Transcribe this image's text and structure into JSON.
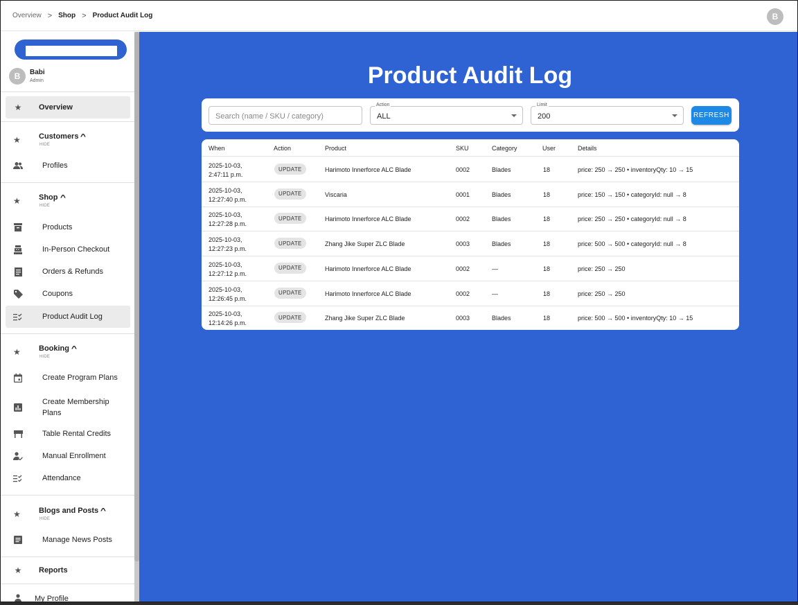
{
  "breadcrumb": {
    "items": [
      "Overview",
      "Shop",
      "Product Audit Log"
    ],
    "separator": ">"
  },
  "top_avatar": "B",
  "user": {
    "initial": "B",
    "name": "Babi",
    "role": "Admin"
  },
  "sidebar": {
    "overview": "Overview",
    "customers": {
      "title": "Customers",
      "hide": "HIDE",
      "items": [
        "Profiles"
      ]
    },
    "shop": {
      "title": "Shop",
      "hide": "HIDE",
      "items": [
        "Products",
        "In-Person Checkout",
        "Orders & Refunds",
        "Coupons",
        "Product Audit Log"
      ]
    },
    "booking": {
      "title": "Booking",
      "hide": "HIDE",
      "items": [
        "Create Program Plans",
        "Create Membership Plans",
        "Table Rental Credits",
        "Manual Enrollment",
        "Attendance"
      ]
    },
    "blogs": {
      "title": "Blogs and Posts",
      "hide": "HIDE",
      "items": [
        "Manage News Posts"
      ]
    },
    "reports": "Reports",
    "my_profile": "My Profile"
  },
  "page_title": "Product Audit Log",
  "filters": {
    "search_placeholder": "Search (name / SKU / category)",
    "action_label": "Action",
    "action_value": "ALL",
    "limit_label": "Limit",
    "limit_value": "200",
    "refresh_label": "REFRESH"
  },
  "table": {
    "headers": [
      "When",
      "Action",
      "Product",
      "SKU",
      "Category",
      "User",
      "Details"
    ],
    "rows": [
      {
        "when": [
          "2025-10-03,",
          "2:47:11 p.m."
        ],
        "action": "UPDATE",
        "product": "Harimoto Innerforce ALC Blade",
        "sku": "0002",
        "category": "Blades",
        "user": "18",
        "details": "price: 250 → 250 • inventoryQty: 10 → 15"
      },
      {
        "when": [
          "2025-10-03,",
          "12:27:40 p.m."
        ],
        "action": "UPDATE",
        "product": "Viscaria",
        "sku": "0001",
        "category": "Blades",
        "user": "18",
        "details": "price: 150 → 150 • categoryId: null → 8"
      },
      {
        "when": [
          "2025-10-03,",
          "12:27:28 p.m."
        ],
        "action": "UPDATE",
        "product": "Harimoto Innerforce ALC Blade",
        "sku": "0002",
        "category": "Blades",
        "user": "18",
        "details": "price: 250 → 250 • categoryId: null → 8"
      },
      {
        "when": [
          "2025-10-03,",
          "12:27:23 p.m."
        ],
        "action": "UPDATE",
        "product": "Zhang Jike Super ZLC Blade",
        "sku": "0003",
        "category": "Blades",
        "user": "18",
        "details": "price: 500 → 500 • categoryId: null → 8"
      },
      {
        "when": [
          "2025-10-03,",
          "12:27:12 p.m."
        ],
        "action": "UPDATE",
        "product": "Harimoto Innerforce ALC Blade",
        "sku": "0002",
        "category": "—",
        "user": "18",
        "details": "price: 250 → 250"
      },
      {
        "when": [
          "2025-10-03,",
          "12:26:45 p.m."
        ],
        "action": "UPDATE",
        "product": "Harimoto Innerforce ALC Blade",
        "sku": "0002",
        "category": "—",
        "user": "18",
        "details": "price: 250 → 250"
      },
      {
        "when": [
          "2025-10-03,",
          "12:14:26 p.m."
        ],
        "action": "UPDATE",
        "product": "Zhang Jike Super ZLC Blade",
        "sku": "0003",
        "category": "Blades",
        "user": "18",
        "details": "price: 500 → 500 • inventoryQty: 10 → 15"
      }
    ]
  },
  "colors": {
    "main_bg": "#2f62d2",
    "accent_button": "#1e88e5",
    "pill": "#2f63d1"
  }
}
